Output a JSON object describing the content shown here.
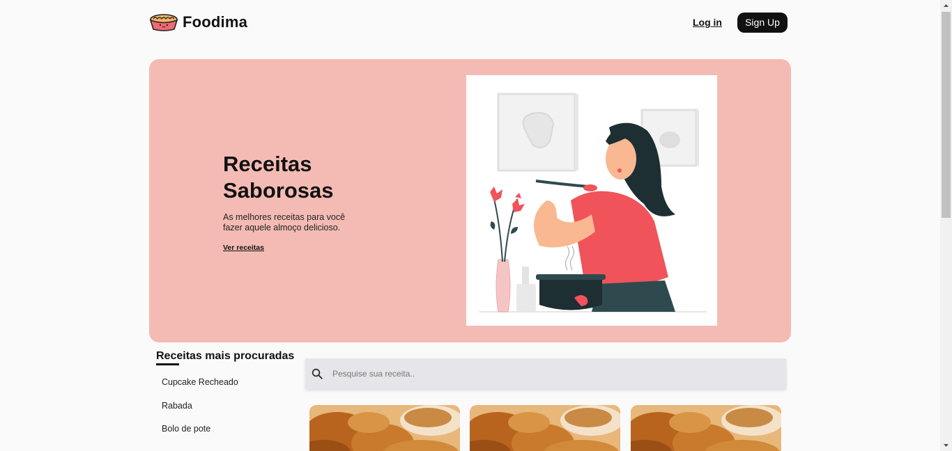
{
  "header": {
    "brand": "Foodima",
    "login_label": "Log in",
    "signup_label": "Sign Up"
  },
  "hero": {
    "title_line1": "Receitas",
    "title_line2": "Saborosas",
    "subtitle": "As melhores receitas para você fazer aquele almoço delicioso.",
    "link_label": "Ver receitas"
  },
  "sidebar": {
    "title": "Receitas mais procuradas",
    "items": [
      {
        "label": "Cupcake Recheado"
      },
      {
        "label": "Rabada"
      },
      {
        "label": "Bolo de pote"
      }
    ]
  },
  "search": {
    "placeholder": "Pesquise sua receita.."
  },
  "colors": {
    "hero_bg": "#f4bbb4",
    "accent_red": "#f0535a",
    "button_dark": "#111111",
    "search_bg": "#e6e5e9"
  },
  "icons": {
    "logo": "pie-logo-icon",
    "search": "search-icon"
  }
}
